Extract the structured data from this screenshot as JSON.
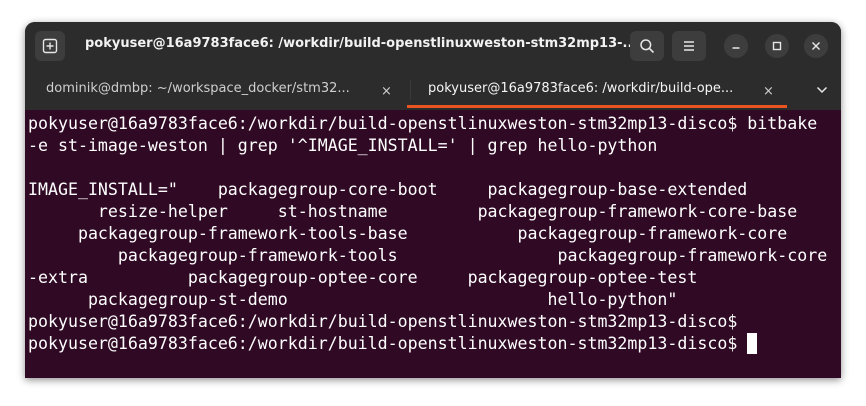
{
  "window": {
    "title": "pokyuser@16a9783face6: /workdir/build-openstlinuxweston-stm32mp13-...",
    "bg_color": "#300a24",
    "accent_color": "#e95420"
  },
  "titlebar": {
    "new_tab_icon": "new-tab-icon",
    "search_icon": "search-icon",
    "menu_icon": "hamburger-menu-icon",
    "minimize_icon": "minimize-icon",
    "maximize_icon": "maximize-icon",
    "close_icon": "close-icon"
  },
  "tabs": [
    {
      "label": "dominik@dmbp: ~/workspace_docker/stm32...",
      "active": false,
      "close_glyph": "×"
    },
    {
      "label": "pokyuser@16a9783face6: /workdir/build-ope...",
      "active": true,
      "close_glyph": "×"
    }
  ],
  "terminal": {
    "lines": [
      "pokyuser@16a9783face6:/workdir/build-openstlinuxweston-stm32mp13-disco$ bitbake",
      "-e st-image-weston | grep '^IMAGE_INSTALL=' | grep hello-python",
      "",
      "IMAGE_INSTALL=\"    packagegroup-core-boot     packagegroup-base-extended",
      "       resize-helper     st-hostname         packagegroup-framework-core-base",
      "     packagegroup-framework-tools-base           packagegroup-framework-core",
      "         packagegroup-framework-tools                packagegroup-framework-core",
      "-extra          packagegroup-optee-core     packagegroup-optee-test",
      "      packagegroup-st-demo                          hello-python\"",
      "pokyuser@16a9783face6:/workdir/build-openstlinuxweston-stm32mp13-disco$"
    ],
    "prompt_line": "pokyuser@16a9783face6:/workdir/build-openstlinuxweston-stm32mp13-disco$"
  }
}
